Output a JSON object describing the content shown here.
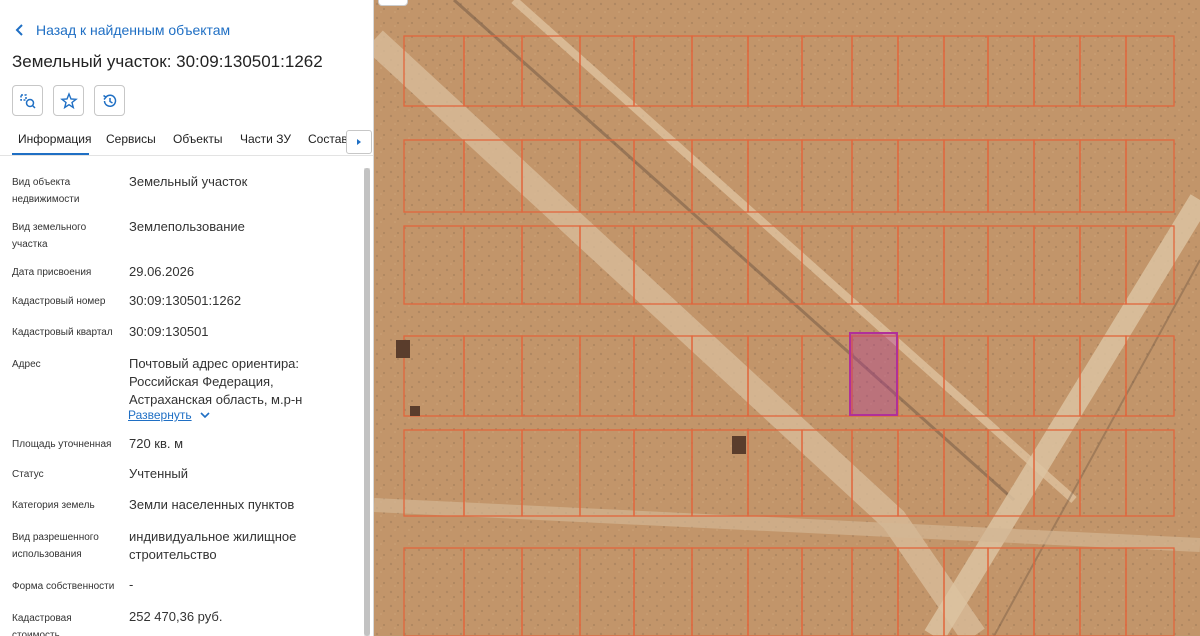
{
  "back_label": "Назад к найденным объектам",
  "title": "Земельный участок: 30:09:130501:1262",
  "actions": [
    {
      "icon": "map-search-icon"
    },
    {
      "icon": "star-icon"
    },
    {
      "icon": "history-icon"
    }
  ],
  "tabs": [
    "Информация",
    "Сервисы",
    "Объекты",
    "Части ЗУ",
    "Состав"
  ],
  "info": {
    "type_label": "Вид объекта недвижимости",
    "type_value": "Земельный участок",
    "land_kind_label": "Вид земельного участка",
    "land_kind_value": "Землепользование",
    "date_label": "Дата присвоения",
    "date_value": "29.06.2026",
    "cad_num_label": "Кадастровый номер",
    "cad_num_value": "30:09:130501:1262",
    "cad_quarter_label": "Кадастровый квартал",
    "cad_quarter_value": "30:09:130501",
    "address_label": "Адрес",
    "address_value": "Почтовый адрес ориентира: Российская Федерация, Астраханская область, м.р-н",
    "expand_label": "Развернуть",
    "area_label": "Площадь уточненная",
    "area_value": "720 кв. м",
    "status_label": "Статус",
    "status_value": "Учтенный",
    "category_label": "Категория земель",
    "category_value": "Земли населенных пунктов",
    "usage_label": "Вид разрешенного использования",
    "usage_value": "индивидуальное жилищное строительство",
    "ownership_label": "Форма собственности",
    "ownership_value": "-",
    "cost_label": "Кадастровая стоимость",
    "cost_value": "252 470,36 руб."
  },
  "colors": {
    "accent": "#1f6fc4",
    "parcel_border": "#e2663c",
    "selected_parcel": "#b0309a",
    "ground": "#c2956a"
  }
}
